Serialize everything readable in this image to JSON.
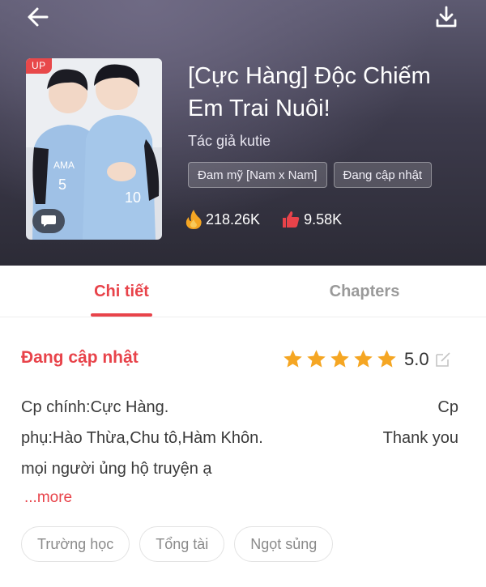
{
  "header": {
    "title": "[Cực Hàng] Độc Chiếm Em Trai Nuôi!",
    "author": "Tác giả kutie",
    "cover_badge": "UP",
    "genre_tags": [
      "Đam mỹ [Nam x Nam]",
      "Đang cập nhật"
    ],
    "views": "218.26K",
    "likes": "9.58K",
    "icons": [
      "back-arrow-icon",
      "download-icon",
      "chat-bubble-icon",
      "fire-icon",
      "thumbs-up-icon"
    ]
  },
  "tabs": [
    {
      "label": "Chi tiết",
      "active": true
    },
    {
      "label": "Chapters",
      "active": false
    }
  ],
  "detail": {
    "status": "Đang cập nhật",
    "rating": "5.0",
    "stars": 5,
    "description_lines": [
      {
        "left": "Cp chính:Cực Hàng.",
        "right": "Cp"
      },
      {
        "left": "phụ:Hào Thừa,Chu tô,Hàm Khôn.",
        "right": "Thank you"
      },
      {
        "left": "mọi người ủng hộ truyện ạ",
        "right": ""
      }
    ],
    "more_label": "...more",
    "tags": [
      "Trường học",
      "Tổng tài",
      "Ngọt sủng"
    ]
  },
  "colors": {
    "accent": "#e8434a",
    "star": "#f5a623",
    "header_bg": "#3d3b4c"
  }
}
